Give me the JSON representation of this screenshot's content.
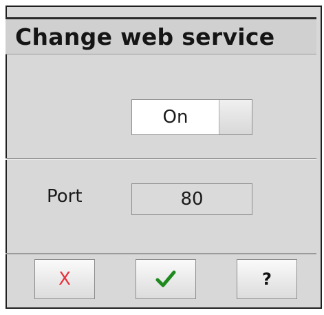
{
  "dialog": {
    "title": "Change web service"
  },
  "service": {
    "toggle_state": "On"
  },
  "port": {
    "label": "Port",
    "value": "80"
  },
  "footer": {
    "cancel_glyph": "X",
    "ok_icon": "checkmark-icon",
    "help_glyph": "?"
  },
  "colors": {
    "cancel_red": "#e8323c",
    "ok_green": "#1e8a1e",
    "panel_gray": "#d8d8d8"
  }
}
